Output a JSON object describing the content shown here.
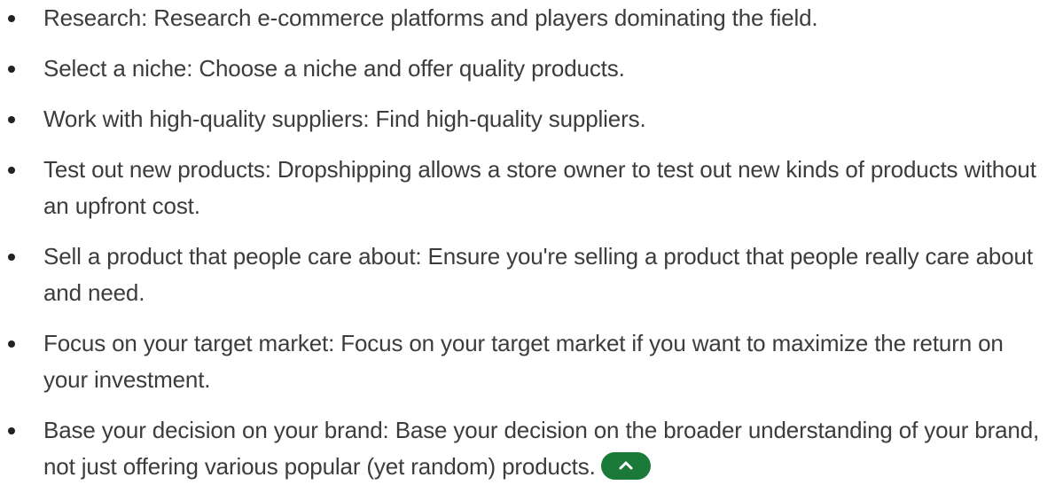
{
  "list": {
    "items": [
      {
        "text": "Research: Research e-commerce platforms and players dominating the field."
      },
      {
        "text": "Select a niche: Choose a niche and offer quality products."
      },
      {
        "text": "Work with high-quality suppliers: Find high-quality suppliers."
      },
      {
        "text": "Test out new products: Dropshipping allows a store owner to test out new kinds of products without an upfront cost."
      },
      {
        "text": "Sell a product that people care about: Ensure you're selling a product that people really care about and need."
      },
      {
        "text": "Focus on your target market: Focus on your target market if you want to maximize the return on your investment."
      },
      {
        "text": "Base your decision on your brand: Base your decision on the broader understanding of your brand, not just offering various popular (yet random) products."
      }
    ]
  },
  "toggle": {
    "icon": "chevron-up-icon",
    "color": "#1b7a37"
  }
}
